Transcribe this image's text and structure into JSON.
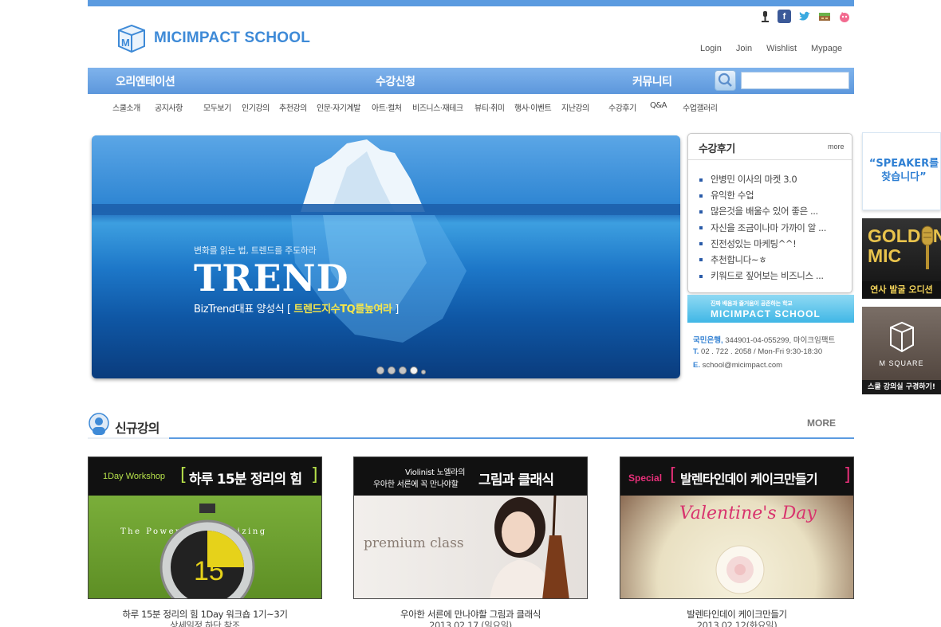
{
  "brand": {
    "name": "MICIMPACT SCHOOL"
  },
  "social": [
    "podcast-icon",
    "facebook-icon",
    "twitter-icon",
    "blog-icon",
    "character-icon"
  ],
  "util_links": {
    "login": "Login",
    "join": "Join",
    "wishlist": "Wishlist",
    "mypage": "Mypage"
  },
  "main_nav": {
    "orientation": "오리엔테이션",
    "enroll": "수강신청",
    "community": "커뮤니티"
  },
  "search": {
    "placeholder": ""
  },
  "sub_nav": [
    "스쿨소개",
    "공지사항",
    "모두보기",
    "인기강의",
    "추천강의",
    "인문·자기계발",
    "아트·컬처",
    "비즈니스·재테크",
    "뷰티·취미",
    "행사·이벤트",
    "지난강의",
    "수강후기",
    "Q&A",
    "수업갤러리"
  ],
  "hero": {
    "subtitle": "변화를 읽는 법, 트렌드를 주도하라",
    "title": "TREND",
    "caption_prefix": "BizTrend대표 양성식 [ ",
    "caption_highlight": "트렌드지수TQ를높여라",
    "caption_suffix": " ]",
    "slide_index": 3
  },
  "review": {
    "title": "수강후기",
    "more": "more",
    "items": [
      "안병민 이사의 마켓 3.0",
      "유익한 수업",
      "많은것을 배울수 있어 좋은 ...",
      "자신을 조금이나마 가까이 알 ...",
      "진전성있는 마케팅^^!",
      "추천합니다~ㅎ",
      "키워드로 짚어보는 비즈니스 ..."
    ]
  },
  "contact": {
    "banner_sub": "진짜 배움과 즐거움이 공존하는 학교",
    "banner_name": "MICIMPACT SCHOOL",
    "bank_label": "국민은행,",
    "bank_value": " 344901-04-055299, 마이크임팩트",
    "tel_label": "T.",
    "tel_value": " 02 . 722 . 2058 / Mon-Fri 9:30-18:30",
    "email_label": "E.",
    "email_value": " school@micimpact.com"
  },
  "side_banners": {
    "speaker": "“SPEAKER를 찾습니다”",
    "golden_title": "GOLDEN MIC",
    "golden_foot": "연사 발굴 오디션",
    "msquare_name": "M SQUARE",
    "msquare_foot": "스쿨 강의실 구경하기!"
  },
  "new_lectures": {
    "title": "신규강의",
    "more": "MORE",
    "cards": [
      {
        "tag": "1Day Workshop",
        "heading": "하루 15분 정리의 힘",
        "art_text": "The Power of Organizing",
        "art_number": "15",
        "caption": "하루 15분 정리의 힘 1Day 워크숍 1기~3기",
        "date": "상세일정 하단 참조"
      },
      {
        "tag": "Violinist 노엘라의",
        "tag2": "우아한 서른에 꼭 만나야할",
        "heading": "그림과 클래식",
        "art_text": "premium class",
        "caption": "우아한 서른에 만나야할 그림과 클래식",
        "date": "2013.02.17 (일요일)"
      },
      {
        "tag": "Special",
        "heading": "발렌타인데이 케이크만들기",
        "art_text": "Valentine's Day",
        "caption": "발렌타인데이 케이크만들기",
        "date": "2013.02.12(화요일)"
      }
    ]
  },
  "colors": {
    "accent": "#5b9be0",
    "logo": "#3e8ad7",
    "highlight": "#f5e64c"
  }
}
